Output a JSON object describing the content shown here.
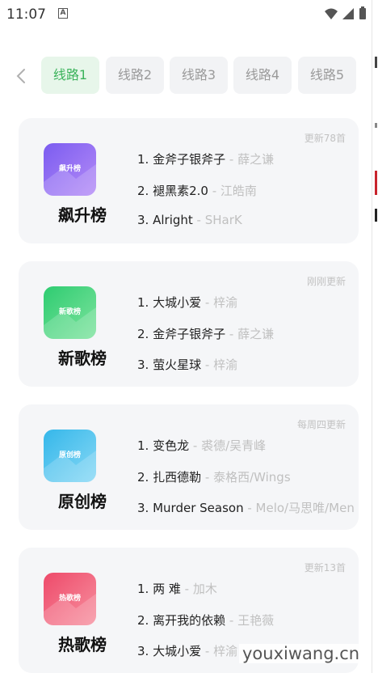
{
  "status": {
    "time": "11:07",
    "notification_icon": "A"
  },
  "routes": [
    "线路1",
    "线路2",
    "线路3",
    "线路4",
    "线路5"
  ],
  "active_route": 0,
  "charts": [
    {
      "name": "飙升榜",
      "cover_label": "飙升榜",
      "update": "更新78首",
      "colors": [
        "#7b5cf0",
        "#b48bf7"
      ],
      "songs": [
        {
          "prefix": "1. ",
          "title": "金斧子银斧子",
          "sep": " - ",
          "artist": "薛之谦"
        },
        {
          "prefix": "2. ",
          "title": "褪黑素2.0",
          "sep": " - ",
          "artist": "江皓南"
        },
        {
          "prefix": "3. ",
          "title": "Alright",
          "sep": " - ",
          "artist": "SHarK"
        }
      ]
    },
    {
      "name": "新歌榜",
      "cover_label": "新歌榜",
      "update": "刚刚更新",
      "colors": [
        "#2ecc71",
        "#7de39d"
      ],
      "songs": [
        {
          "prefix": "1. ",
          "title": "大城小爱",
          "sep": " - ",
          "artist": "梓渝"
        },
        {
          "prefix": "2. ",
          "title": "金斧子银斧子",
          "sep": " - ",
          "artist": "薛之谦"
        },
        {
          "prefix": "3. ",
          "title": "萤火星球",
          "sep": " - ",
          "artist": "梓渝"
        }
      ]
    },
    {
      "name": "原创榜",
      "cover_label": "原创榜",
      "update": "每周四更新",
      "colors": [
        "#35b7ea",
        "#86d8f5"
      ],
      "songs": [
        {
          "prefix": "1. ",
          "title": "变色龙",
          "sep": " - ",
          "artist": "裘德/吴青峰"
        },
        {
          "prefix": "2. ",
          "title": "扎西德勒",
          "sep": " - ",
          "artist": "泰格西/Wings"
        },
        {
          "prefix": "3. ",
          "title": "Murder Season",
          "sep": " - ",
          "artist": "Melo/马思唯/Men..."
        }
      ]
    },
    {
      "name": "热歌榜",
      "cover_label": "热歌榜",
      "update": "更新13首",
      "colors": [
        "#ee4a6a",
        "#f7909f"
      ],
      "songs": [
        {
          "prefix": "1. ",
          "title": "两 难",
          "sep": " - ",
          "artist": "加木"
        },
        {
          "prefix": "2. ",
          "title": "离开我的依赖",
          "sep": " - ",
          "artist": "王艳薇"
        },
        {
          "prefix": "3. ",
          "title": "大城小爱",
          "sep": " - ",
          "artist": "梓渝"
        }
      ]
    }
  ],
  "watermark": "youxiwang.cn"
}
